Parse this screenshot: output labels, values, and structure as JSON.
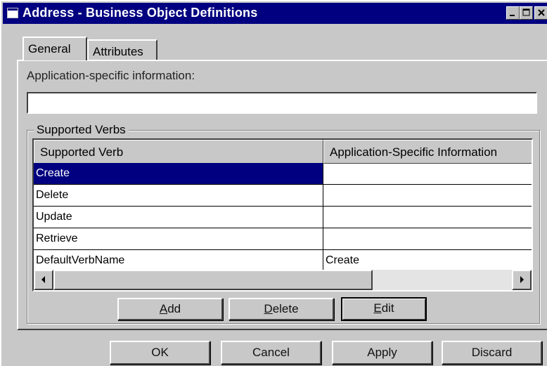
{
  "window": {
    "title": "Address - Business Object Definitions",
    "colors": {
      "titlebar": "#000080",
      "selection": "#000080",
      "face": "#c8c8c8"
    }
  },
  "title_controls": {
    "minimize": "minimize-icon",
    "maximize": "maximize-icon",
    "close": "close-icon"
  },
  "tabs": [
    {
      "label": "General",
      "active": true
    },
    {
      "label": "Attributes",
      "active": false
    }
  ],
  "general": {
    "app_info_label": "Application-specific information:",
    "app_info_value": ""
  },
  "verbs_group": {
    "title": "Supported Verbs",
    "columns": [
      "Supported Verb",
      "Application-Specific Information"
    ],
    "rows": [
      {
        "verb": "Create",
        "info": "",
        "selected": true
      },
      {
        "verb": "Delete",
        "info": ""
      },
      {
        "verb": "Update",
        "info": ""
      },
      {
        "verb": "Retrieve",
        "info": ""
      },
      {
        "verb": "DefaultVerbName",
        "info": "Create"
      }
    ],
    "buttons": {
      "add": {
        "pre": "",
        "accel": "A",
        "post": "dd"
      },
      "delete": {
        "pre": "",
        "accel": "D",
        "post": "elete"
      },
      "edit": {
        "pre": "",
        "accel": "E",
        "post": "dit"
      }
    }
  },
  "footer": {
    "ok": "OK",
    "cancel": "Cancel",
    "apply": "Apply",
    "discard": "Discard"
  }
}
